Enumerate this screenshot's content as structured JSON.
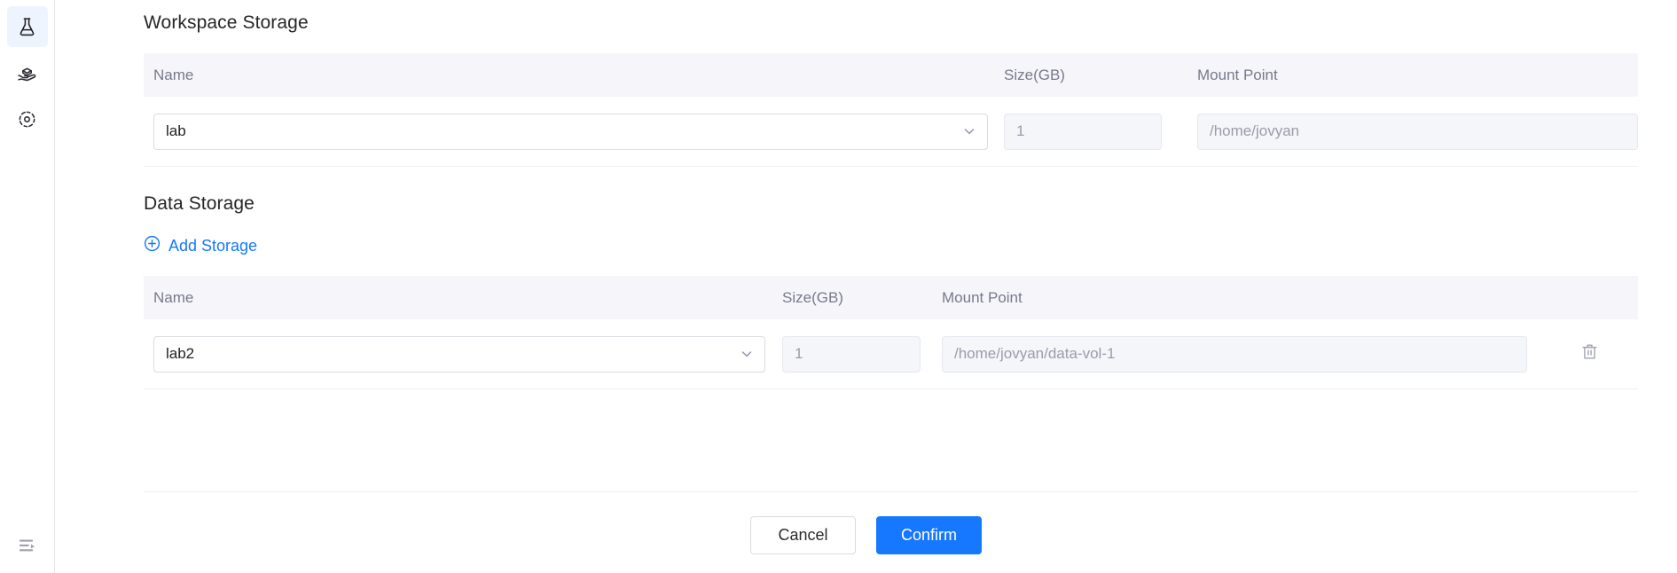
{
  "sidebar": {
    "items": [
      {
        "icon": "flask-icon",
        "name": "sidebar-item-experiments",
        "active": true
      },
      {
        "icon": "hand-box-icon",
        "name": "sidebar-item-resources",
        "active": false
      },
      {
        "icon": "gear-icon",
        "name": "sidebar-item-settings",
        "active": false
      }
    ],
    "bottom": {
      "icon": "collapse-panel-icon",
      "name": "sidebar-collapse-toggle"
    }
  },
  "workspace_storage": {
    "title": "Workspace Storage",
    "columns": {
      "name": "Name",
      "size": "Size(GB)",
      "mount": "Mount Point"
    },
    "rows": [
      {
        "name": "lab",
        "size": "1",
        "mount": "/home/jovyan"
      }
    ]
  },
  "data_storage": {
    "title": "Data Storage",
    "add_label": "Add Storage",
    "add_icon": "plus-circle-icon",
    "columns": {
      "name": "Name",
      "size": "Size(GB)",
      "mount": "Mount Point"
    },
    "rows": [
      {
        "name": "lab2",
        "size": "1",
        "mount": "/home/jovyan/data-vol-1",
        "delete_icon": "trash-icon"
      }
    ]
  },
  "footer": {
    "cancel_label": "Cancel",
    "confirm_label": "Confirm"
  },
  "colors": {
    "accent": "#1677ff",
    "header_bg": "#f6f6fa",
    "muted_text": "#77798c",
    "disabled_bg": "#f5f6fa",
    "rail_active_bg": "#eef4fe"
  }
}
